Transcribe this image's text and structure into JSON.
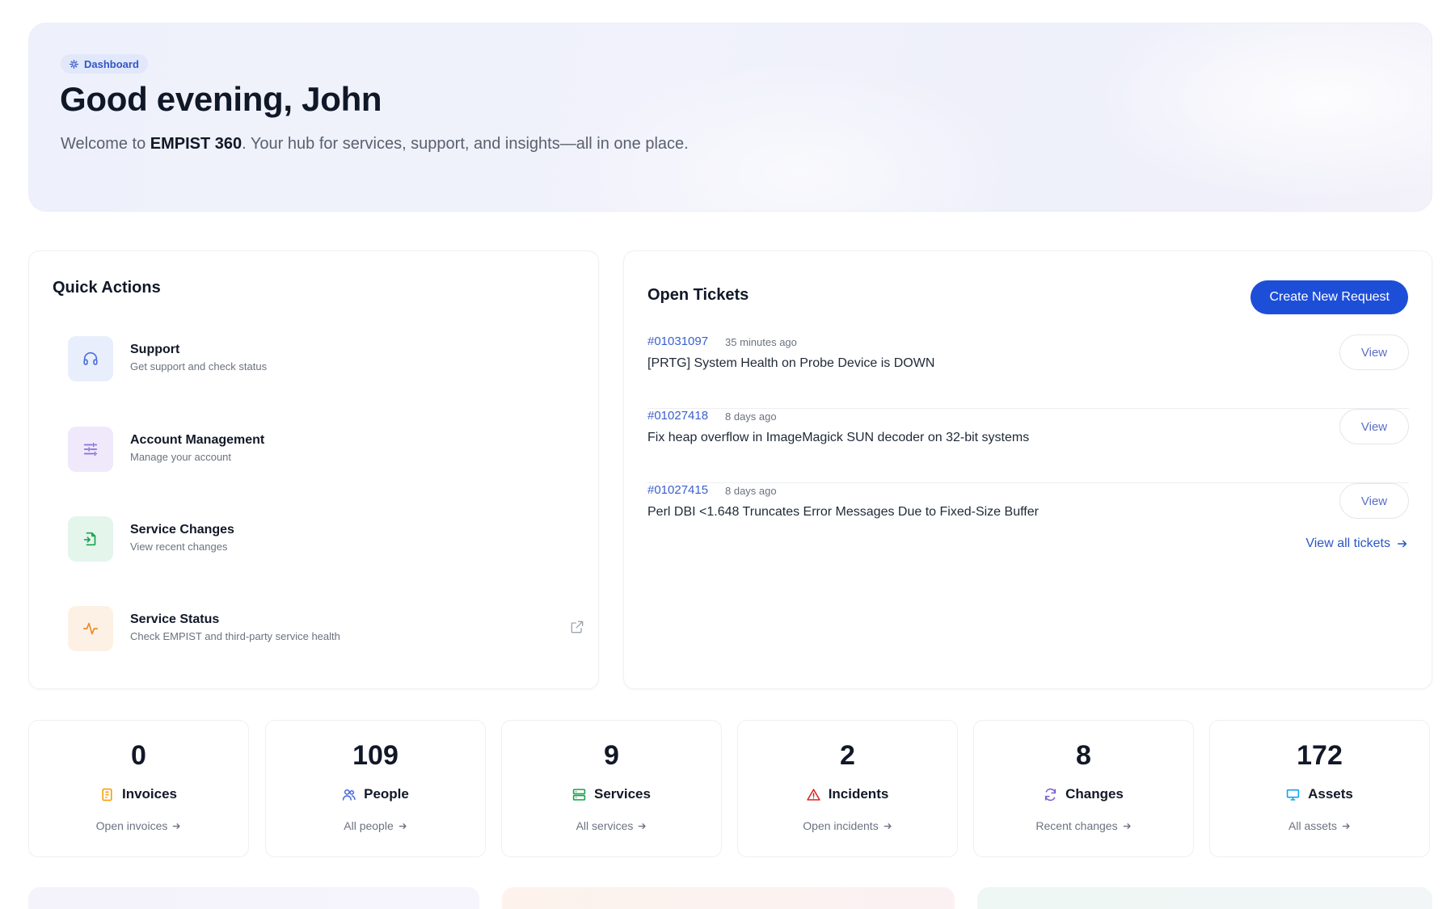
{
  "hero": {
    "badge": "Dashboard",
    "title": "Good evening, John",
    "subtitle_prefix": "Welcome to ",
    "subtitle_brand": "EMPIST 360",
    "subtitle_suffix": ". Your hub for services, support, and insights—all in one place."
  },
  "quick_actions": {
    "title": "Quick Actions",
    "items": [
      {
        "name": "Support",
        "desc": "Get support and check status",
        "icon": "headphones-icon"
      },
      {
        "name": "Account Management",
        "desc": "Manage your account",
        "icon": "sliders-icon"
      },
      {
        "name": "Service Changes",
        "desc": "View recent changes",
        "icon": "file-change-icon"
      },
      {
        "name": "Service Status",
        "desc": "Check EMPIST and third-party service health",
        "icon": "activity-icon"
      }
    ]
  },
  "open_tickets": {
    "title": "Open Tickets",
    "create_label": "Create New Request",
    "view_label": "View",
    "view_all_label": "View all tickets",
    "tickets": [
      {
        "id": "#01031097",
        "time": "35 minutes ago",
        "title": "[PRTG] System Health on Probe Device is DOWN"
      },
      {
        "id": "#01027418",
        "time": "8 days ago",
        "title": "Fix heap overflow in ImageMagick SUN decoder on 32-bit systems"
      },
      {
        "id": "#01027415",
        "time": "8 days ago",
        "title": "Perl DBI <1.648 Truncates Error Messages Due to Fixed-Size Buffer"
      }
    ]
  },
  "stats": [
    {
      "value": "0",
      "label": "Invoices",
      "link": "Open invoices",
      "icon": "invoice-icon",
      "color": "#f59e0b"
    },
    {
      "value": "109",
      "label": "People",
      "link": "All people",
      "icon": "people-icon",
      "color": "#4f6fd8"
    },
    {
      "value": "9",
      "label": "Services",
      "link": "All services",
      "icon": "server-icon",
      "color": "#16a34a"
    },
    {
      "value": "2",
      "label": "Incidents",
      "link": "Open incidents",
      "icon": "warning-icon",
      "color": "#dc2626"
    },
    {
      "value": "8",
      "label": "Changes",
      "link": "Recent changes",
      "icon": "refresh-icon",
      "color": "#7c5fd8"
    },
    {
      "value": "172",
      "label": "Assets",
      "link": "All assets",
      "icon": "monitor-icon",
      "color": "#0ea5e9"
    }
  ],
  "colors": {
    "primary": "#1d4ed8",
    "link": "#3b5fce",
    "hero_bg": "#eef1fb"
  }
}
